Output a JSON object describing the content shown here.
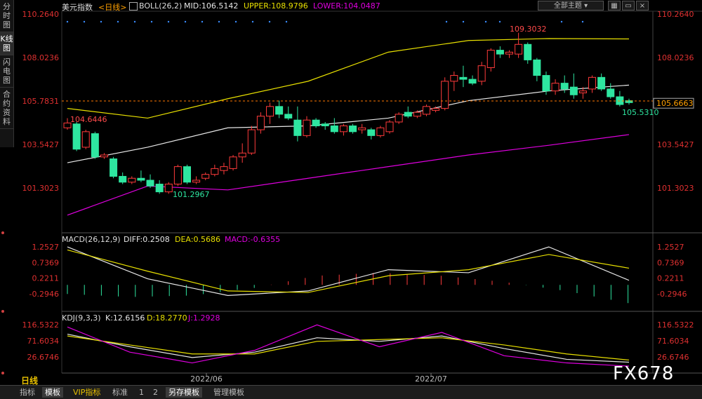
{
  "side_tabs": [
    "分时图",
    "K线图",
    "闪电图",
    "合约资料"
  ],
  "active_side_tab": 1,
  "theme_select": "全部主题",
  "top_icons": [
    "grid-icon",
    "window-icon",
    "close-icon"
  ],
  "main_panel": {
    "instrument": "美元指数",
    "period_label": "<日线>",
    "indicator": "BOLL(26,2)",
    "mid": "MID:106.5142",
    "upper": "UPPER:108.9796",
    "lower": "LOWER:104.0487",
    "axis_labels": [
      "110.2640",
      "108.0236",
      "105.7831",
      "103.5427",
      "101.3023"
    ],
    "current_price": "105.6663",
    "annotations": [
      "104.6446",
      "101.2967",
      "109.3032",
      "105.5310"
    ]
  },
  "macd_panel": {
    "indicator": "MACD(26,12,9)",
    "diff": "DIFF:0.2508",
    "dea": "DEA:0.5686",
    "macd": "MACD:-0.6355",
    "axis_labels": [
      "1.2527",
      "0.7369",
      "0.2211",
      "-0.2946"
    ]
  },
  "kdj_panel": {
    "indicator": "KDJ(9,3,3)",
    "k": "K:12.6156",
    "d": "D:18.2770",
    "j": "J:1.2928",
    "axis_labels": [
      "116.5322",
      "71.6034",
      "26.6746"
    ]
  },
  "x_axis_labels": [
    "2022/06",
    "2022/07"
  ],
  "period_tab": "日线",
  "bottom_tabs": [
    "指标",
    "模板",
    "VIP指标",
    "标准",
    "1",
    "2",
    "另存模板",
    "管理模板"
  ],
  "watermark": "FX678",
  "colors": {
    "up": "#ff3b3b",
    "down": "#2ee6a0",
    "mid": "#e8e8e8",
    "upper": "#e8e000",
    "lower": "#e000e0",
    "price_line": "#ff7800",
    "label_orange": "#ffb000",
    "label_magenta": "#e060e0"
  },
  "chart_data": {
    "type": "candlestick",
    "candles": [
      {
        "o": 104.4,
        "h": 104.9,
        "l": 104.3,
        "c": 104.65
      },
      {
        "o": 104.6,
        "h": 104.7,
        "l": 103.2,
        "c": 103.3
      },
      {
        "o": 103.4,
        "h": 104.3,
        "l": 103.3,
        "c": 104.2
      },
      {
        "o": 104.1,
        "h": 104.2,
        "l": 102.8,
        "c": 102.9
      },
      {
        "o": 102.9,
        "h": 103.1,
        "l": 102.8,
        "c": 103.0
      },
      {
        "o": 102.8,
        "h": 102.9,
        "l": 101.8,
        "c": 101.9
      },
      {
        "o": 101.9,
        "h": 102.1,
        "l": 101.5,
        "c": 101.6
      },
      {
        "o": 101.6,
        "h": 101.9,
        "l": 101.5,
        "c": 101.8
      },
      {
        "o": 101.8,
        "h": 102.2,
        "l": 101.6,
        "c": 101.7
      },
      {
        "o": 101.7,
        "h": 102.0,
        "l": 101.3,
        "c": 101.4
      },
      {
        "o": 101.5,
        "h": 101.7,
        "l": 101.0,
        "c": 101.1
      },
      {
        "o": 101.1,
        "h": 101.6,
        "l": 101.0,
        "c": 101.5
      },
      {
        "o": 101.5,
        "h": 102.5,
        "l": 101.4,
        "c": 102.4
      },
      {
        "o": 102.4,
        "h": 102.5,
        "l": 101.5,
        "c": 101.6
      },
      {
        "o": 101.6,
        "h": 101.9,
        "l": 101.5,
        "c": 101.7
      },
      {
        "o": 101.8,
        "h": 102.1,
        "l": 101.7,
        "c": 102.0
      },
      {
        "o": 102.0,
        "h": 102.5,
        "l": 101.9,
        "c": 102.3
      },
      {
        "o": 102.2,
        "h": 102.6,
        "l": 102.0,
        "c": 102.4
      },
      {
        "o": 102.3,
        "h": 103.0,
        "l": 102.2,
        "c": 102.9
      },
      {
        "o": 102.9,
        "h": 103.6,
        "l": 102.6,
        "c": 103.1
      },
      {
        "o": 103.1,
        "h": 104.5,
        "l": 103.0,
        "c": 104.3
      },
      {
        "o": 104.3,
        "h": 105.2,
        "l": 104.1,
        "c": 105.0
      },
      {
        "o": 105.0,
        "h": 105.7,
        "l": 104.6,
        "c": 105.5
      },
      {
        "o": 105.5,
        "h": 105.8,
        "l": 104.9,
        "c": 105.1
      },
      {
        "o": 105.1,
        "h": 105.5,
        "l": 104.8,
        "c": 104.9
      },
      {
        "o": 104.8,
        "h": 105.5,
        "l": 103.7,
        "c": 104.0
      },
      {
        "o": 104.0,
        "h": 105.0,
        "l": 103.9,
        "c": 104.8
      },
      {
        "o": 104.8,
        "h": 104.9,
        "l": 104.4,
        "c": 104.5
      },
      {
        "o": 104.6,
        "h": 104.7,
        "l": 104.3,
        "c": 104.5
      },
      {
        "o": 104.5,
        "h": 104.9,
        "l": 104.1,
        "c": 104.2
      },
      {
        "o": 104.2,
        "h": 104.6,
        "l": 104.0,
        "c": 104.5
      },
      {
        "o": 104.5,
        "h": 104.6,
        "l": 104.1,
        "c": 104.2
      },
      {
        "o": 104.3,
        "h": 104.6,
        "l": 104.1,
        "c": 104.4
      },
      {
        "o": 104.3,
        "h": 104.4,
        "l": 103.8,
        "c": 104.0
      },
      {
        "o": 104.0,
        "h": 104.5,
        "l": 103.9,
        "c": 104.4
      },
      {
        "o": 104.2,
        "h": 104.8,
        "l": 104.1,
        "c": 104.7
      },
      {
        "o": 104.7,
        "h": 105.2,
        "l": 104.6,
        "c": 105.1
      },
      {
        "o": 105.2,
        "h": 105.5,
        "l": 104.9,
        "c": 105.0
      },
      {
        "o": 105.0,
        "h": 105.3,
        "l": 104.9,
        "c": 105.2
      },
      {
        "o": 105.1,
        "h": 105.6,
        "l": 105.0,
        "c": 105.5
      },
      {
        "o": 105.3,
        "h": 105.5,
        "l": 105.2,
        "c": 105.4
      },
      {
        "o": 105.4,
        "h": 107.0,
        "l": 105.3,
        "c": 106.8
      },
      {
        "o": 106.8,
        "h": 107.3,
        "l": 106.3,
        "c": 107.1
      },
      {
        "o": 107.0,
        "h": 107.6,
        "l": 106.5,
        "c": 106.9
      },
      {
        "o": 106.9,
        "h": 107.1,
        "l": 106.6,
        "c": 106.7
      },
      {
        "o": 106.8,
        "h": 107.8,
        "l": 106.6,
        "c": 107.6
      },
      {
        "o": 107.5,
        "h": 108.5,
        "l": 107.3,
        "c": 108.4
      },
      {
        "o": 108.4,
        "h": 108.6,
        "l": 108.0,
        "c": 108.2
      },
      {
        "o": 108.2,
        "h": 108.4,
        "l": 108.0,
        "c": 108.3
      },
      {
        "o": 108.2,
        "h": 109.3,
        "l": 108.0,
        "c": 108.7
      },
      {
        "o": 108.7,
        "h": 108.8,
        "l": 107.7,
        "c": 107.9
      },
      {
        "o": 107.9,
        "h": 108.0,
        "l": 106.8,
        "c": 107.1
      },
      {
        "o": 107.1,
        "h": 107.3,
        "l": 106.1,
        "c": 106.3
      },
      {
        "o": 106.3,
        "h": 106.9,
        "l": 106.1,
        "c": 106.7
      },
      {
        "o": 106.7,
        "h": 107.1,
        "l": 106.2,
        "c": 106.4
      },
      {
        "o": 106.5,
        "h": 107.2,
        "l": 105.9,
        "c": 106.1
      },
      {
        "o": 106.2,
        "h": 106.5,
        "l": 105.9,
        "c": 106.3
      },
      {
        "o": 106.4,
        "h": 107.1,
        "l": 106.2,
        "c": 107.0
      },
      {
        "o": 107.0,
        "h": 107.2,
        "l": 106.3,
        "c": 106.4
      },
      {
        "o": 106.4,
        "h": 106.7,
        "l": 105.9,
        "c": 106.0
      },
      {
        "o": 106.0,
        "h": 106.3,
        "l": 105.5,
        "c": 105.6
      },
      {
        "o": 105.8,
        "h": 105.9,
        "l": 105.6,
        "c": 105.7
      }
    ],
    "boll_mid": [
      102.6,
      103.4,
      104.4,
      104.5,
      104.9,
      105.8,
      106.3,
      106.6
    ],
    "boll_upper": [
      105.4,
      104.9,
      105.9,
      106.8,
      108.3,
      108.9,
      109.0,
      108.98
    ],
    "boll_lower": [
      99.9,
      101.4,
      101.2,
      101.8,
      102.4,
      103.0,
      103.5,
      104.05
    ],
    "macd_diff": [
      1.25,
      0.2,
      -0.35,
      -0.2,
      0.5,
      0.4,
      1.25,
      0.15
    ],
    "macd_dea": [
      1.15,
      0.45,
      -0.2,
      -0.25,
      0.3,
      0.5,
      1.0,
      0.55
    ],
    "macd_hist": [
      -0.3,
      -0.4,
      -0.35,
      -0.1,
      0.3,
      0.4,
      0.3,
      0.1,
      -0.2,
      -0.6
    ],
    "kdj_k": [
      90,
      55,
      25,
      40,
      80,
      70,
      85,
      50,
      20,
      12
    ],
    "kdj_d": [
      85,
      60,
      35,
      35,
      70,
      75,
      80,
      60,
      35,
      18
    ],
    "kdj_j": [
      110,
      40,
      10,
      45,
      116,
      55,
      95,
      30,
      10,
      1
    ]
  }
}
